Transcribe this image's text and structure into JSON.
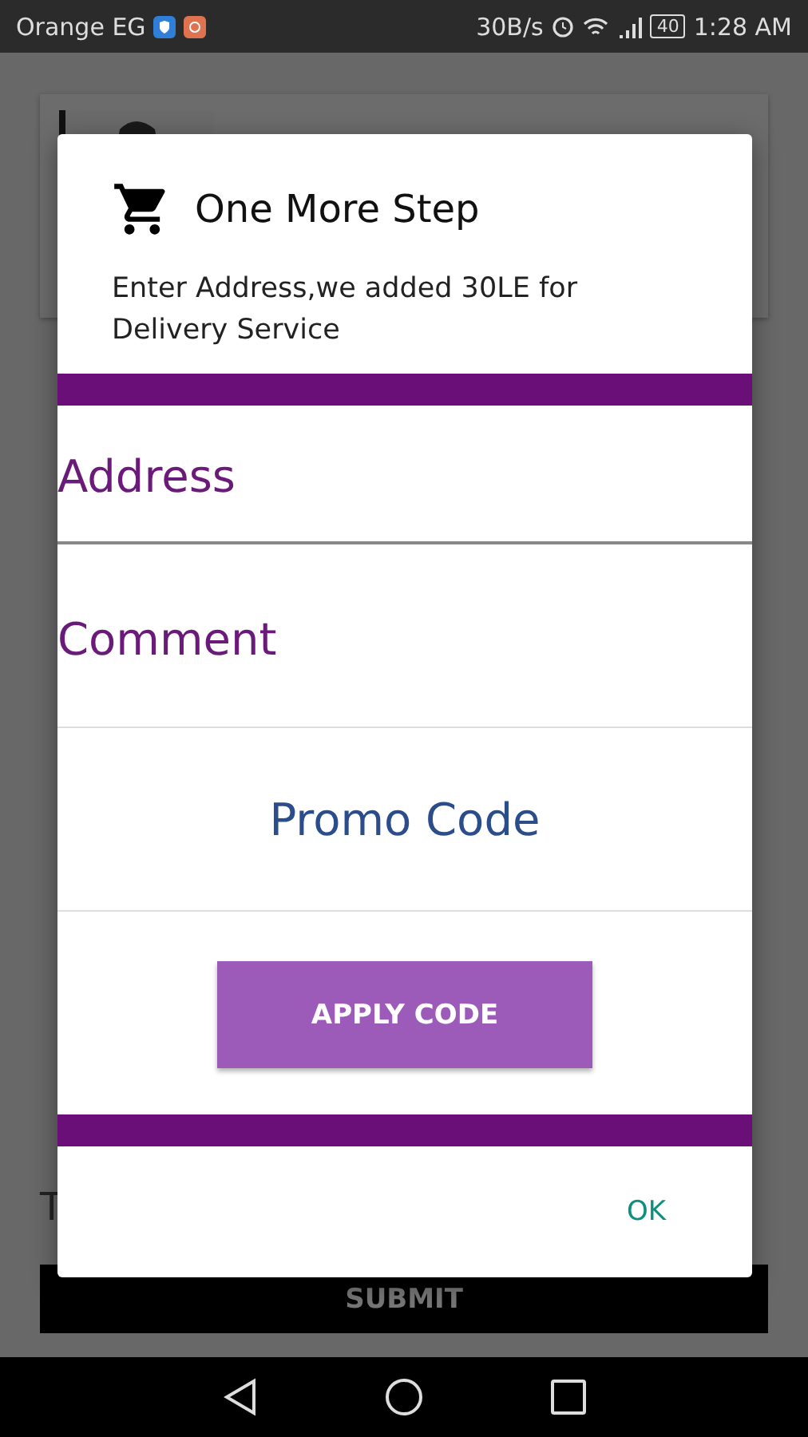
{
  "status_bar": {
    "carrier": "Orange EG",
    "speed": "30B/s",
    "battery": "40",
    "time": "1:28 AM"
  },
  "background": {
    "partial_text": "T",
    "submit": "SUBMIT"
  },
  "dialog": {
    "title": "One More Step",
    "message": "Enter Address,we added 30LE for Delivery Service",
    "fields": [
      {
        "placeholder": "Address",
        "kind": "underline"
      },
      {
        "placeholder": "Comment",
        "kind": "underline"
      },
      {
        "placeholder": "Promo Code",
        "kind": "centered"
      }
    ],
    "apply_button": "APPLY CODE",
    "ok_button": "OK"
  }
}
